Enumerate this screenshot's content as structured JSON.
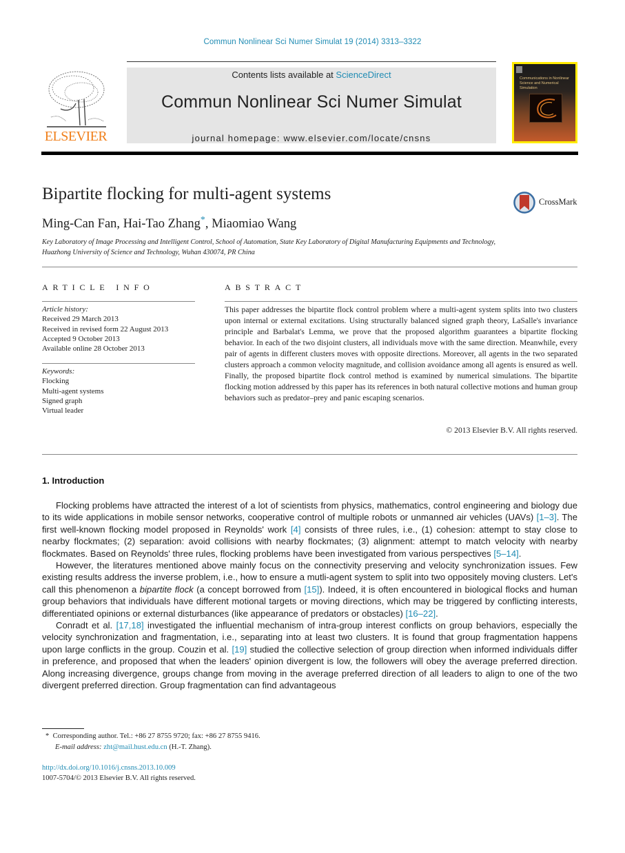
{
  "journal_citation": "Commun Nonlinear Sci Numer Simulat 19 (2014) 3313–3322",
  "publisher": {
    "logo_text": "ELSEVIER"
  },
  "banner": {
    "contents_prefix": "Contents lists available at ",
    "contents_link": "ScienceDirect",
    "journal_title": "Commun Nonlinear Sci Numer Simulat",
    "homepage": "journal homepage: www.elsevier.com/locate/cnsns"
  },
  "cover": {
    "title": "Communications in Nonlinear Science and Numerical Simulation"
  },
  "article": {
    "title": "Bipartite flocking for multi-agent systems",
    "crossmark_label": "CrossMark",
    "authors": {
      "author1": "Ming-Can Fan, ",
      "author2": "Hai-Tao Zhang",
      "author2_mark": "*",
      "author3": ", Miaomiao Wang"
    },
    "affiliation_line1": "Key Laboratory of Image Processing and Intelligent Control, School of Automation, State Key Laboratory of Digital Manufacturing Equipments and Technology,",
    "affiliation_line2": "Huazhong University of Science and Technology, Wuhan 430074, PR China"
  },
  "article_info": {
    "heading": "ARTICLE INFO",
    "history_label": "Article history:",
    "history": [
      "Received 29 March 2013",
      "Received in revised form 22 August 2013",
      "Accepted 9 October 2013",
      "Available online 28 October 2013"
    ],
    "keywords_label": "Keywords:",
    "keywords": [
      "Flocking",
      "Multi-agent systems",
      "Signed graph",
      "Virtual leader"
    ]
  },
  "abstract": {
    "heading": "ABSTRACT",
    "text": "This paper addresses the bipartite flock control problem where a multi-agent system splits into two clusters upon internal or external excitations. Using structurally balanced signed graph theory, LaSalle's invariance principle and Barbalat's Lemma, we prove that the proposed algorithm guarantees a bipartite flocking behavior. In each of the two disjoint clusters, all individuals move with the same direction. Meanwhile, every pair of agents in different clusters moves with opposite directions. Moreover, all agents in the two separated clusters approach a common velocity magnitude, and collision avoidance among all agents is ensured as well. Finally, the proposed bipartite flock control method is examined by numerical simulations. The bipartite flocking motion addressed by this paper has its references in both natural collective motions and human group behaviors such as predator–prey and panic escaping scenarios.",
    "copyright": "© 2013 Elsevier B.V. All rights reserved."
  },
  "introduction": {
    "heading": "1. Introduction",
    "p1": {
      "a": "Flocking problems have attracted the interest of a lot of scientists from physics, mathematics, control engineering and biology due to its wide applications in mobile sensor networks, cooperative control of multiple robots or unmanned air vehicles (UAVs) ",
      "ref1": "[1–3]",
      "b": ". The first well-known flocking model proposed in Reynolds' work ",
      "ref2": "[4]",
      "c": " consists of three rules, i.e., (1) cohesion: attempt to stay close to nearby flockmates; (2) separation: avoid collisions with nearby flockmates; (3) alignment: attempt to match velocity with nearby flockmates. Based on Reynolds' three rules, flocking problems have been investigated from various perspectives ",
      "ref3": "[5–14]",
      "d": "."
    },
    "p2": {
      "a": "However, the literatures mentioned above mainly focus on the connectivity preserving and velocity synchronization issues. Few existing results address the inverse problem, i.e., how to ensure a mutli-agent system to split into two oppositely moving clusters. Let's call this phenomenon a ",
      "em": "bipartite flock",
      "b": " (a concept borrowed from ",
      "ref1": "[15]",
      "c": "). Indeed, it is often encountered in biological flocks and human group behaviors that individuals have different motional targets or moving directions, which may be triggered by conflicting interests, differentiated opinions or external disturbances (like appearance of predators or obstacles) ",
      "ref2": "[16–22]",
      "d": "."
    },
    "p3": {
      "a": "Conradt et al. ",
      "ref1": "[17,18]",
      "b": " investigated the influential mechanism of intra-group interest conflicts on group behaviors, especially the velocity synchronization and fragmentation, i.e., separating into at least two clusters. It is found that group fragmentation happens upon large conflicts in the group. Couzin et al. ",
      "ref2": "[19]",
      "c": " studied the collective selection of group direction when informed individuals differ in preference, and proposed that when the leaders' opinion divergent is low, the followers will obey the average preferred direction. Along increasing divergence, groups change from moving in the average preferred direction of all leaders to align to one of the two divergent preferred direction. Group fragmentation can find advantageous"
    }
  },
  "footnotes": {
    "mark": "*",
    "corresponding": "Corresponding author. Tel.: +86 27 8755 9720; fax: +86 27 8755 9416.",
    "email_label": "E-mail address: ",
    "email": "zht@mail.hust.edu.cn",
    "email_owner": " (H.-T. Zhang).",
    "doi": "http://dx.doi.org/10.1016/j.cnsns.2013.10.009",
    "issn_copyright": "1007-5704/© 2013 Elsevier B.V. All rights reserved."
  },
  "colors": {
    "link": "#1f8bb3",
    "elsevier_orange": "#f07f1a",
    "banner_bg": "#e5e5e5",
    "cover_border": "#ffeb00"
  }
}
